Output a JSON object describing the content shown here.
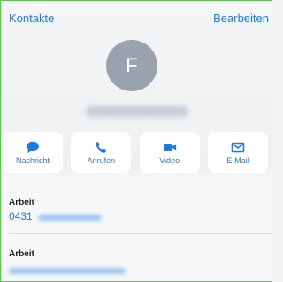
{
  "nav": {
    "back_label": "Kontakte",
    "edit_label": "Bearbeiten"
  },
  "contact": {
    "initial": "F"
  },
  "actions": [
    {
      "label": "Nachricht",
      "icon": "message-icon"
    },
    {
      "label": "Anrufen",
      "icon": "phone-icon"
    },
    {
      "label": "Video",
      "icon": "video-camera-icon"
    },
    {
      "label": "E-Mail",
      "icon": "mail-icon"
    }
  ],
  "fields": [
    {
      "label": "Arbeit",
      "value": "0431"
    },
    {
      "label": "Arbeit",
      "value": ""
    }
  ],
  "colors": {
    "accent": "#1f7ae8",
    "avatar": "#9aa2ae",
    "border": "#5fc34f"
  }
}
